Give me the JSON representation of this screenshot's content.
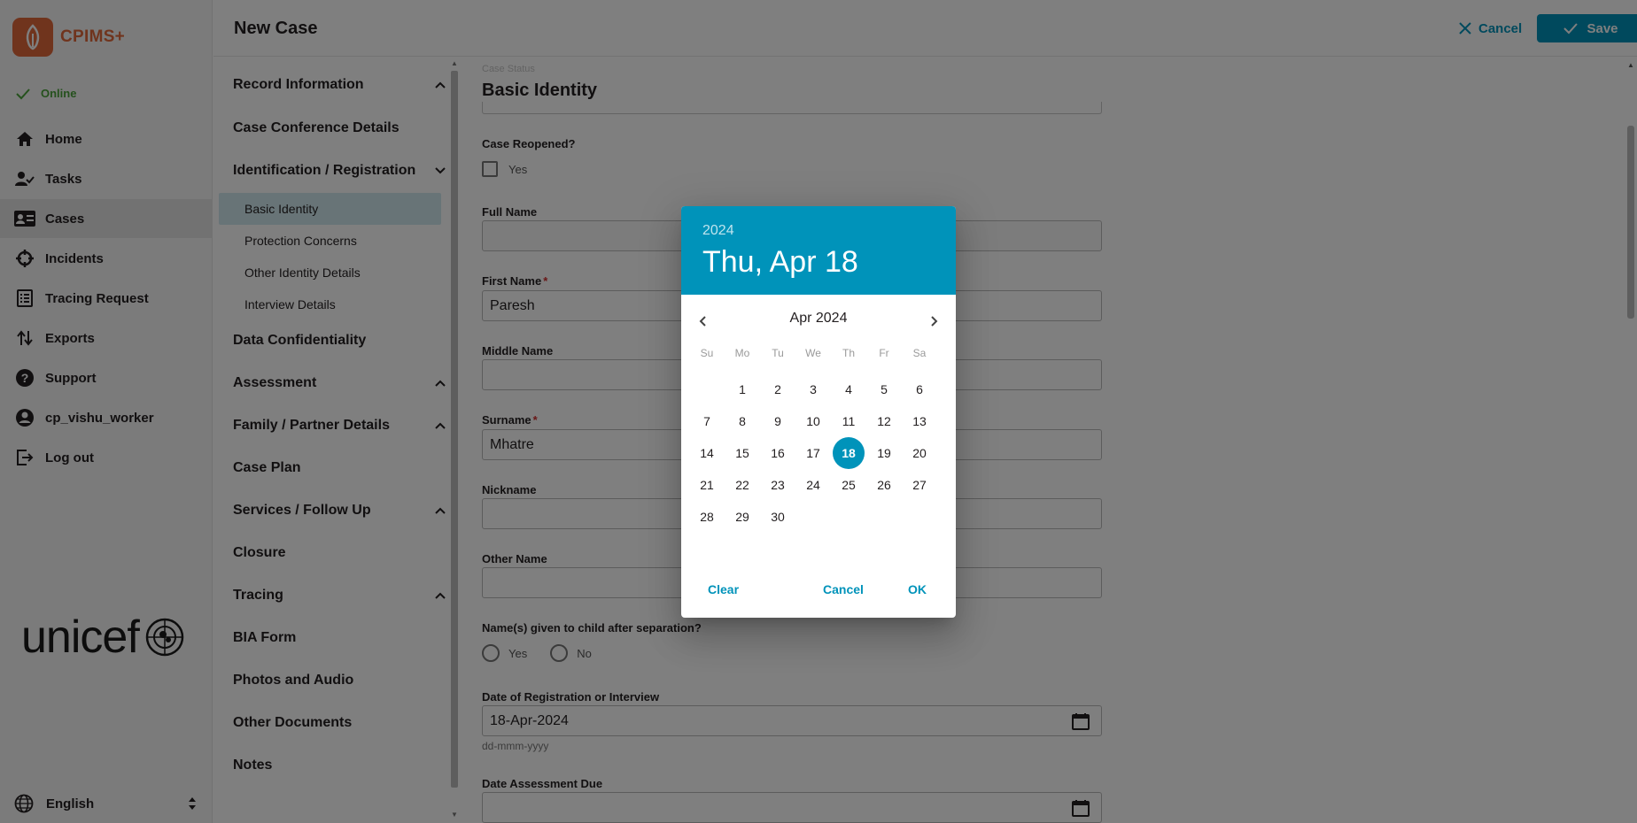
{
  "brand": {
    "name": "CPIMS+",
    "logo_color": "#e0683b"
  },
  "nav": {
    "status": "Online",
    "items": [
      {
        "label": "Home",
        "icon": "home-icon"
      },
      {
        "label": "Tasks",
        "icon": "tasks-icon"
      },
      {
        "label": "Cases",
        "icon": "cases-icon",
        "active": true
      },
      {
        "label": "Incidents",
        "icon": "incidents-icon"
      },
      {
        "label": "Tracing Request",
        "icon": "tracing-request-icon"
      },
      {
        "label": "Exports",
        "icon": "exports-icon"
      },
      {
        "label": "Support",
        "icon": "help-icon"
      },
      {
        "label": "cp_vishu_worker",
        "icon": "account-icon"
      },
      {
        "label": "Log out",
        "icon": "logout-icon"
      }
    ],
    "partner_logo": "unicef",
    "language": "English"
  },
  "header": {
    "title": "New Case",
    "cancel_label": "Cancel",
    "save_label": "Save",
    "accent": "#0093ba"
  },
  "form_nav": {
    "sections": [
      "Record Information",
      "Case Conference Details",
      "Identification / Registration",
      "Data Confidentiality",
      "Assessment",
      "Family / Partner Details",
      "Case Plan",
      "Services / Follow Up",
      "Closure",
      "Tracing",
      "BIA Form",
      "Photos and Audio",
      "Other Documents",
      "Notes"
    ],
    "subsections": [
      "Basic Identity",
      "Protection Concerns",
      "Other Identity Details",
      "Interview Details"
    ],
    "active_subsection": "Basic Identity"
  },
  "form": {
    "ghost_label": "Case Status",
    "section_title": "Basic Identity",
    "case_reopened_label": "Case Reopened?",
    "case_reopened_option": "Yes",
    "full_name_label": "Full Name",
    "full_name_value": "",
    "first_name_label": "First Name",
    "first_name_value": "Paresh",
    "middle_name_label": "Middle Name",
    "middle_name_value": "",
    "surname_label": "Surname",
    "surname_value": "Mhatre",
    "nickname_label": "Nickname",
    "nickname_value": "",
    "other_name_label": "Other Name",
    "other_name_value": "",
    "names_after_sep_label": "Name(s) given to child after separation?",
    "yes_label": "Yes",
    "no_label": "No",
    "registration_date_label": "Date of Registration or Interview",
    "registration_date_value": "18-Apr-2024",
    "date_format_hint": "dd-mmm-yyyy",
    "assessment_due_label": "Date Assessment Due",
    "assessment_due_value": ""
  },
  "datepicker": {
    "year": "2024",
    "selected_label": "Thu, Apr 18",
    "month_label": "Apr 2024",
    "weekdays": [
      "Su",
      "Mo",
      "Tu",
      "We",
      "Th",
      "Fr",
      "Sa"
    ],
    "first_weekday_index": 1,
    "days_in_month": 30,
    "selected_day": 18,
    "clear_label": "Clear",
    "cancel_label": "Cancel",
    "ok_label": "OK"
  }
}
